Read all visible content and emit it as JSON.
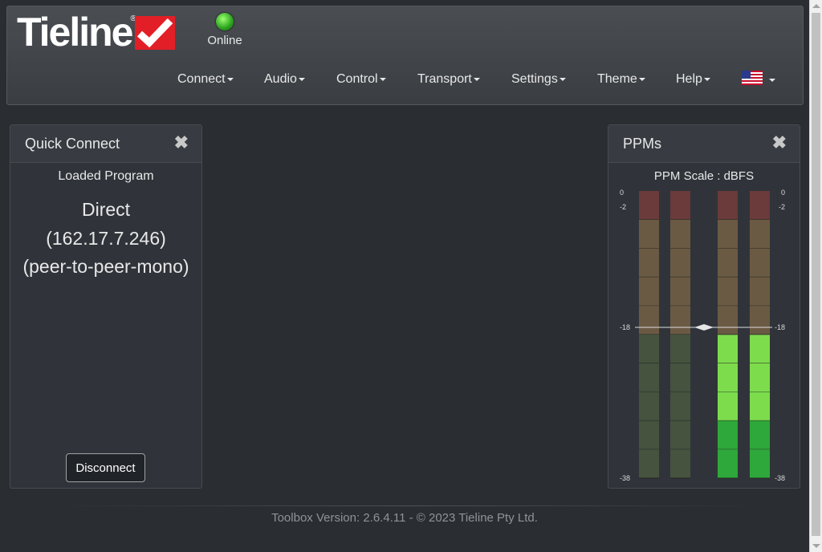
{
  "header": {
    "logo_text": "Tieline",
    "status_label": "Online",
    "status_color": "#2aa11d"
  },
  "nav": {
    "items": [
      {
        "label": "Connect"
      },
      {
        "label": "Audio"
      },
      {
        "label": "Control"
      },
      {
        "label": "Transport"
      },
      {
        "label": "Settings"
      },
      {
        "label": "Theme"
      },
      {
        "label": "Help"
      }
    ],
    "language_icon": "us-flag-icon"
  },
  "quick_connect": {
    "title": "Quick Connect",
    "loaded_program_label": "Loaded Program",
    "program_name": "Direct",
    "program_ip": "(162.17.7.246)",
    "program_mode": "(peer-to-peer-mono)",
    "disconnect_label": "Disconnect"
  },
  "ppms": {
    "title": "PPMs",
    "scale_label": "PPM Scale  : dBFS",
    "tick_labels": [
      "0",
      "-2",
      "-18",
      "-38"
    ],
    "meter_levels_dbfs": [
      null,
      null,
      -19,
      -19
    ],
    "colors": {
      "active_green": "#7ddc4c",
      "active_green_dark": "#2ea83a",
      "inactive_red": "#6b3a3a",
      "inactive_amber": "#6b5a43",
      "inactive_green": "#45533f"
    }
  },
  "footer": {
    "text": "Toolbox Version: 2.6.4.11 - © 2023 Tieline Pty Ltd."
  }
}
